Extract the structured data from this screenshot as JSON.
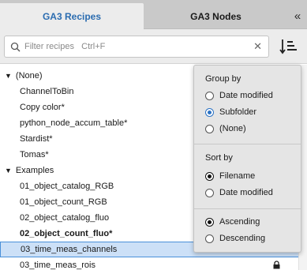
{
  "tabs": [
    {
      "label": "GA3 Recipes",
      "active": true
    },
    {
      "label": "GA3 Nodes",
      "active": false
    }
  ],
  "collapse_glyph": "«",
  "search": {
    "placeholder": "Filter recipes   Ctrl+F",
    "value": ""
  },
  "clear_glyph": "✕",
  "tree": [
    {
      "kind": "group",
      "caret": "▼",
      "label": "(None)"
    },
    {
      "kind": "item",
      "label": "ChannelToBin"
    },
    {
      "kind": "item",
      "label": "Copy color*"
    },
    {
      "kind": "item",
      "label": "python_node_accum_table*"
    },
    {
      "kind": "item",
      "label": "Stardist*"
    },
    {
      "kind": "item",
      "label": "Tomas*"
    },
    {
      "kind": "group",
      "caret": "▼",
      "label": "Examples"
    },
    {
      "kind": "item",
      "label": "01_object_catalog_RGB"
    },
    {
      "kind": "item",
      "label": "01_object_count_RGB"
    },
    {
      "kind": "item",
      "label": "02_object_catalog_fluo"
    },
    {
      "kind": "item",
      "label": "02_object_count_fluo*",
      "bold": true
    },
    {
      "kind": "item",
      "label": "03_time_meas_channels",
      "selected": true
    },
    {
      "kind": "item",
      "label": "03_time_meas_rois",
      "locked": true
    }
  ],
  "popup": {
    "group_by": {
      "heading": "Group by",
      "options": [
        {
          "label": "Date modified",
          "checked": false
        },
        {
          "label": "Subfolder",
          "checked": true
        },
        {
          "label": "(None)",
          "checked": false
        }
      ]
    },
    "sort_by": {
      "heading": "Sort by",
      "options": [
        {
          "label": "Filename",
          "checked": true
        },
        {
          "label": "Date modified",
          "checked": false
        }
      ]
    },
    "order": {
      "options": [
        {
          "label": "Ascending",
          "checked": true
        },
        {
          "label": "Descending",
          "checked": false
        }
      ]
    }
  },
  "colors": {
    "accent": "#2b6cb0",
    "selection": "#cce0f7",
    "selection_border": "#4a90d9",
    "radio_blue": "#2b72c4"
  }
}
